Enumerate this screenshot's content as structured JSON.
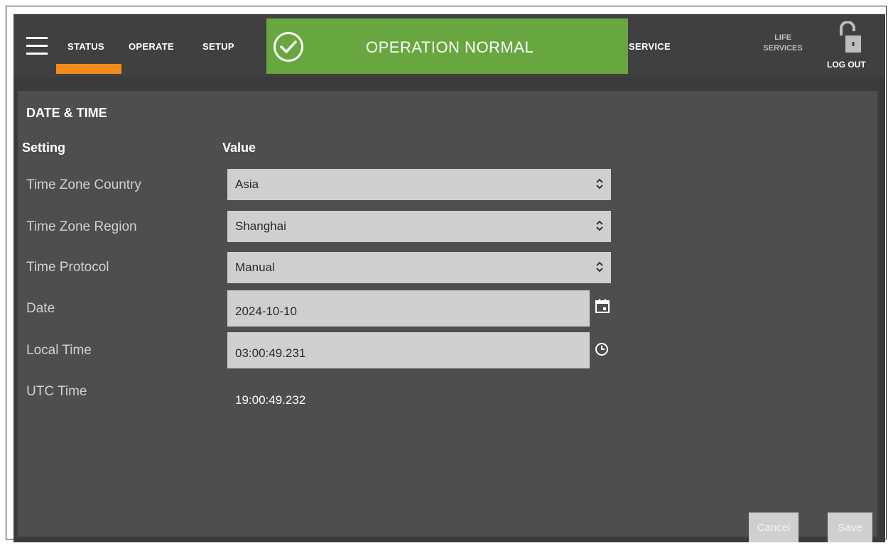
{
  "nav": {
    "status": "STATUS",
    "operate": "OPERATE",
    "setup": "SETUP",
    "service": "SERVICE",
    "life_services_line1": "LIFE",
    "life_services_line2": "SERVICES",
    "logout": "LOG OUT",
    "active_tab": "STATUS"
  },
  "status_banner": {
    "text": "OPERATION NORMAL",
    "icon": "check-circle-icon",
    "color": "#68a63f"
  },
  "panel": {
    "title": "DATE & TIME",
    "columns": {
      "setting": "Setting",
      "value": "Value"
    },
    "rows": [
      {
        "label": "Time Zone Country",
        "value": "Asia",
        "type": "select"
      },
      {
        "label": "Time Zone Region",
        "value": "Shanghai",
        "type": "select"
      },
      {
        "label": "Time Protocol",
        "value": "Manual",
        "type": "select"
      },
      {
        "label": "Date",
        "value": "2024-10-10",
        "type": "date",
        "icon": "calendar-icon"
      },
      {
        "label": "Local Time",
        "value": "03:00:49.231",
        "type": "time",
        "icon": "clock-icon"
      },
      {
        "label": "UTC Time",
        "value": "19:00:49.232",
        "type": "readonly"
      }
    ]
  },
  "buttons": {
    "cancel": "Cancel",
    "save": "Save"
  },
  "colors": {
    "accent_underline": "#f28a1c",
    "header_bg": "#3f403f",
    "panel_bg": "#4d4e4d",
    "field_bg": "#cfcfcf"
  }
}
